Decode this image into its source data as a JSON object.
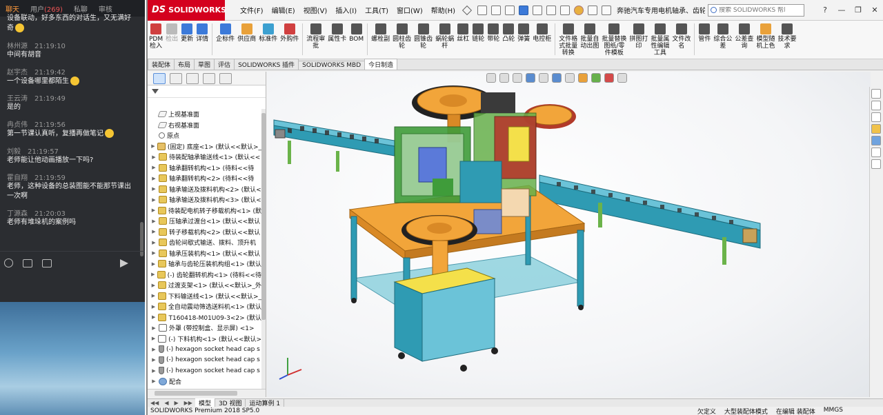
{
  "chat": {
    "tabs": [
      {
        "label": "聊天",
        "active": true
      },
      {
        "label": "用户",
        "count": "(269)"
      },
      {
        "label": "私聊"
      },
      {
        "label": "审核"
      }
    ],
    "first_text": "设备联动，好多东西的对话生，又无满好奇",
    "messages": [
      {
        "user": "林州源",
        "time": "21:19:10",
        "text": "中间有胡音",
        "emoji": false
      },
      {
        "user": "赵宇杰",
        "time": "21:19:42",
        "text": "一个设备哪里都陌生",
        "emoji": true
      },
      {
        "user": "王云涛",
        "time": "21:19:49",
        "text": "是的",
        "emoji": false
      },
      {
        "user": "冉贞伟",
        "time": "21:19:56",
        "text": "第一节课认真听，复播再做笔记",
        "emoji": true
      },
      {
        "user": "刘毅",
        "time": "21:19:57",
        "text": "老师能让他动画播放一下吗?",
        "emoji": false
      },
      {
        "user": "霍自翔",
        "time": "21:19:59",
        "text": "老师，这种设备的总装图能不能那节课出一次啊",
        "emoji": false
      },
      {
        "user": "丁源森",
        "time": "21:20:03",
        "text": "老师有堆垛机的案例吗",
        "emoji": false
      }
    ]
  },
  "sw": {
    "logo": "SOLIDWORKS",
    "logo_mark": "DS",
    "menu": [
      "文件(F)",
      "编辑(E)",
      "视图(V)",
      "插入(I)",
      "工具(T)",
      "窗口(W)",
      "帮助(H)"
    ],
    "doc_title": "奔驰汽车专用电机轴承、齿轮...",
    "search_placeholder": "搜索 SOLIDWORKS 帮助",
    "ribbon": [
      {
        "label": "PDM\n检入",
        "color": "#d04040"
      },
      {
        "label": "检出",
        "color": "#bbbbbb",
        "disabled": true
      },
      {
        "label": "更新",
        "color": "#3c7ad9"
      },
      {
        "label": "详情",
        "color": "#3c7ad9"
      },
      {
        "sep": true
      },
      {
        "label": "企标件",
        "color": "#3c7ad9"
      },
      {
        "label": "供应商",
        "color": "#e9a13a"
      },
      {
        "label": "标准件",
        "color": "#3ca0d0"
      },
      {
        "label": "外购件",
        "color": "#d04040"
      },
      {
        "sep": true
      },
      {
        "label": "流程审\n批",
        "color": "#555555"
      },
      {
        "label": "属性卡",
        "color": "#555555"
      },
      {
        "label": "BOM",
        "color": "#555555"
      },
      {
        "sep": true
      },
      {
        "label": "螺栓副",
        "color": "#555555"
      },
      {
        "label": "圆柱齿\n轮",
        "color": "#555555"
      },
      {
        "label": "圆锥齿\n轮",
        "color": "#555555"
      },
      {
        "label": "蜗轮蜗\n杆",
        "color": "#555555"
      },
      {
        "label": "丝杠",
        "color": "#555555"
      },
      {
        "label": "链轮",
        "color": "#555555"
      },
      {
        "label": "带轮",
        "color": "#555555"
      },
      {
        "label": "凸轮",
        "color": "#555555"
      },
      {
        "label": "弹簧",
        "color": "#555555"
      },
      {
        "label": "电控柜",
        "color": "#555555"
      },
      {
        "sep": true
      },
      {
        "label": "文件格\n式批量\n转换",
        "color": "#555555"
      },
      {
        "label": "批量自\n动出图",
        "color": "#555555"
      },
      {
        "label": "批量替换\n图纸/零\n件模板",
        "color": "#555555"
      },
      {
        "label": "拼图打\n印",
        "color": "#555555"
      },
      {
        "label": "批量属\n性编辑\n工具",
        "color": "#555555"
      },
      {
        "label": "文件改\n名",
        "color": "#555555"
      },
      {
        "sep": true
      },
      {
        "label": "管件",
        "color": "#555555"
      },
      {
        "label": "综合公\n差",
        "color": "#555555"
      },
      {
        "label": "公差查\n询",
        "color": "#555555"
      },
      {
        "label": "模型随\n机上色",
        "color": "#e9a13a"
      },
      {
        "label": "技术要\n求",
        "color": "#555555"
      }
    ],
    "cmd_tabs": [
      {
        "label": "装配体"
      },
      {
        "label": "布局"
      },
      {
        "label": "草图"
      },
      {
        "label": "评估"
      },
      {
        "label": "SOLIDWORKS 插件"
      },
      {
        "label": "SOLIDWORKS MBD"
      },
      {
        "label": "今日制造",
        "active": true
      }
    ],
    "tree": [
      {
        "label": "上视基准面",
        "icon": "plane",
        "exp": ""
      },
      {
        "label": "右视基准面",
        "icon": "plane",
        "exp": ""
      },
      {
        "label": "原点",
        "icon": "origin",
        "exp": ""
      },
      {
        "label": "(固定) 底座<1> (默认<<默认>_",
        "icon": "part",
        "exp": "▶"
      },
      {
        "label": "待装配轴承输送线<1> (默认<<",
        "icon": "asm",
        "exp": "▶"
      },
      {
        "label": "轴承翻转机构<1> (待料<<待",
        "icon": "asm",
        "exp": "▶"
      },
      {
        "label": "轴承翻转机构<2> (待料<<待",
        "icon": "asm",
        "exp": "▶"
      },
      {
        "label": "轴承输送及拨料机构<2> (默认<",
        "icon": "asm",
        "exp": "▶"
      },
      {
        "label": "轴承输送及拨料机构<3> (默认<",
        "icon": "asm",
        "exp": "▶"
      },
      {
        "label": "待装配电机转子移载机构<1> (默",
        "icon": "asm",
        "exp": "▶"
      },
      {
        "label": "压轴承过渡台<1> (默认<<默认",
        "icon": "asm",
        "exp": "▶"
      },
      {
        "label": "转子移载机构<2> (默认<<默认",
        "icon": "asm",
        "exp": "▶"
      },
      {
        "label": "齿轮间歇式输送、拨料、顶升机",
        "icon": "asm",
        "exp": "▶"
      },
      {
        "label": "轴承压装机构<1> (默认<<默认",
        "icon": "asm",
        "exp": "▶"
      },
      {
        "label": "轴承与齿轮压装机构组<1> (默认",
        "icon": "asm",
        "exp": "▶"
      },
      {
        "label": "(-) 齿轮翻转机构<1> (待料<<待",
        "icon": "asm",
        "exp": "▶"
      },
      {
        "label": "过渡支架<1> (默认<<默认>_外",
        "icon": "asm",
        "exp": "▶"
      },
      {
        "label": "下料输送线<1> (默认<<默认>_",
        "icon": "asm",
        "exp": "▶"
      },
      {
        "label": "全自动震动筛选送料机<1> (默认",
        "icon": "asm",
        "exp": "▶"
      },
      {
        "label": "T160418-M01U09-3<2> (默认",
        "icon": "asm",
        "exp": "▶"
      },
      {
        "label": "外罩 (带控制盒、显示屏) <1>",
        "icon": "outline",
        "exp": "▶"
      },
      {
        "label": "(-) 下料机构<1> (默认<<默认>",
        "icon": "outline",
        "exp": "▶"
      },
      {
        "label": "(-) hexagon socket head cap s",
        "icon": "screw",
        "exp": "▶"
      },
      {
        "label": "(-) hexagon socket head cap s",
        "icon": "screw",
        "exp": "▶"
      },
      {
        "label": "(-) hexagon socket head cap s",
        "icon": "screw",
        "exp": "▶"
      },
      {
        "label": "配合",
        "icon": "mate",
        "exp": "▶"
      }
    ],
    "bottom_tabs": [
      {
        "label": "模型",
        "active": true
      },
      {
        "label": "3D 视图"
      },
      {
        "label": "运动算例 1"
      }
    ],
    "status_left": "SOLIDWORKS Premium 2018 SP5.0",
    "status_right": [
      "欠定义",
      "大型装配体模式",
      "在编辑 装配体",
      "MMGS"
    ]
  }
}
